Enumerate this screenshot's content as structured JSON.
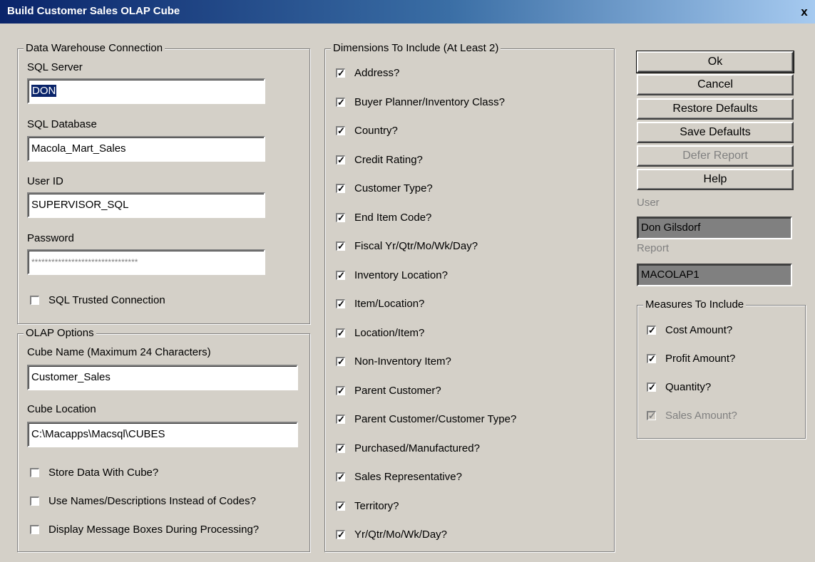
{
  "window": {
    "title": "Build Customer Sales OLAP Cube",
    "close": "x"
  },
  "dw": {
    "group_title": "Data Warehouse Connection",
    "server_label": "SQL Server",
    "server_value": "DON",
    "database_label": "SQL Database",
    "database_value": "Macola_Mart_Sales",
    "userid_label": "User ID",
    "userid_value": "SUPERVISOR_SQL",
    "password_label": "Password",
    "password_value": "********************************",
    "trusted_label": "SQL Trusted Connection"
  },
  "olap": {
    "group_title": "OLAP Options",
    "cube_name_label": "Cube Name (Maximum 24 Characters)",
    "cube_name_value": "Customer_Sales",
    "cube_location_label": "Cube Location",
    "cube_location_value": "C:\\Macapps\\Macsql\\CUBES",
    "options": [
      {
        "label": "Store Data With Cube?",
        "checked": false
      },
      {
        "label": "Use Names/Descriptions Instead of Codes?",
        "checked": false
      },
      {
        "label": "Display Message Boxes During Processing?",
        "checked": false
      }
    ]
  },
  "dimensions": {
    "group_title": "Dimensions To Include (At Least 2)",
    "items": [
      {
        "label": "Address?",
        "checked": true
      },
      {
        "label": "Buyer Planner/Inventory Class?",
        "checked": true
      },
      {
        "label": "Country?",
        "checked": true
      },
      {
        "label": "Credit Rating?",
        "checked": true
      },
      {
        "label": "Customer Type?",
        "checked": true
      },
      {
        "label": "End Item Code?",
        "checked": true
      },
      {
        "label": "Fiscal Yr/Qtr/Mo/Wk/Day?",
        "checked": true
      },
      {
        "label": "Inventory Location?",
        "checked": true
      },
      {
        "label": "Item/Location?",
        "checked": true
      },
      {
        "label": "Location/Item?",
        "checked": true
      },
      {
        "label": "Non-Inventory Item?",
        "checked": true
      },
      {
        "label": "Parent Customer?",
        "checked": true
      },
      {
        "label": "Parent Customer/Customer Type?",
        "checked": true
      },
      {
        "label": "Purchased/Manufactured?",
        "checked": true
      },
      {
        "label": "Sales Representative?",
        "checked": true
      },
      {
        "label": "Territory?",
        "checked": true
      },
      {
        "label": "Yr/Qtr/Mo/Wk/Day?",
        "checked": true
      }
    ]
  },
  "buttons": {
    "ok": "Ok",
    "cancel": "Cancel",
    "restore": "Restore Defaults",
    "save": "Save Defaults",
    "defer": "Defer Report",
    "help": "Help"
  },
  "user": {
    "label": "User",
    "value": "Don Gilsdorf"
  },
  "report": {
    "label": "Report",
    "value": "MACOLAP1"
  },
  "measures": {
    "group_title": "Measures To Include",
    "items": [
      {
        "label": "Cost Amount?",
        "checked": true,
        "disabled": false
      },
      {
        "label": "Profit Amount?",
        "checked": true,
        "disabled": false
      },
      {
        "label": "Quantity?",
        "checked": true,
        "disabled": false
      },
      {
        "label": "Sales Amount?",
        "checked": true,
        "disabled": true
      }
    ]
  },
  "check_glyph": "✓"
}
